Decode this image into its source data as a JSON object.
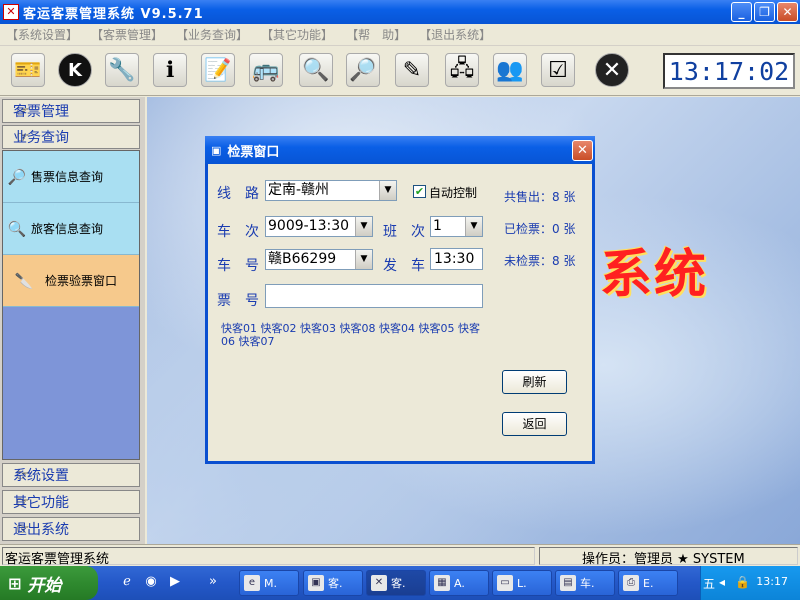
{
  "window": {
    "title": "客运客票管理系统 V9.5.71",
    "icon": "app-icon"
  },
  "menu": [
    "【系统设置】",
    "【客票管理】",
    "【业务查询】",
    "【其它功能】",
    "【帮　助】",
    "【退出系统】"
  ],
  "toolbar": {
    "tools": [
      "ticket-icon",
      "k-icon",
      "tools-icon",
      "info-icon",
      "document-icon",
      "bus-icon",
      "magnifier-icon",
      "search-people-icon",
      "pen-icon",
      "network-icon",
      "users-icon",
      "checklist-icon",
      "close-circle-icon"
    ],
    "clock": "13:17:02"
  },
  "nav": {
    "top": [
      "客票管理",
      "业务查询"
    ],
    "sub": [
      "售票信息查询",
      "旅客信息查询",
      "检票验票窗口"
    ],
    "bottom": [
      "系统设置",
      "其它功能",
      "退出系统"
    ]
  },
  "background": {
    "word": "系统"
  },
  "dialog": {
    "title": "检票窗口",
    "route_label": "线　路",
    "route_value": "定南-赣州",
    "auto_label": "自动控制",
    "auto_checked": "✔",
    "trip_label": "车　次",
    "trip_value": "9009-13:30",
    "shift_label": "班　次",
    "shift_value": "1",
    "plate_label": "车　号",
    "plate_value": "赣B66299",
    "depart_label": "发　车",
    "depart_value": "13:30",
    "ticket_label": "票　号",
    "ticket_value": "",
    "sold": "共售出：8 张",
    "checked": "已检票：0 张",
    "unchecked": "未检票：8 张",
    "buses": "快客01 快客02 快客03 快客08 快客04 快客05 快客06 快客07",
    "refresh": "刷新",
    "back": "返回"
  },
  "status": {
    "left": "客运客票管理系统",
    "right": "操作员：管理员 ★ SYSTEM"
  },
  "taskbar": {
    "start": "开始",
    "tasks": [
      "M.",
      "客.",
      "客.",
      "A.",
      "L.",
      "车.",
      "E."
    ],
    "time": "13:17"
  }
}
